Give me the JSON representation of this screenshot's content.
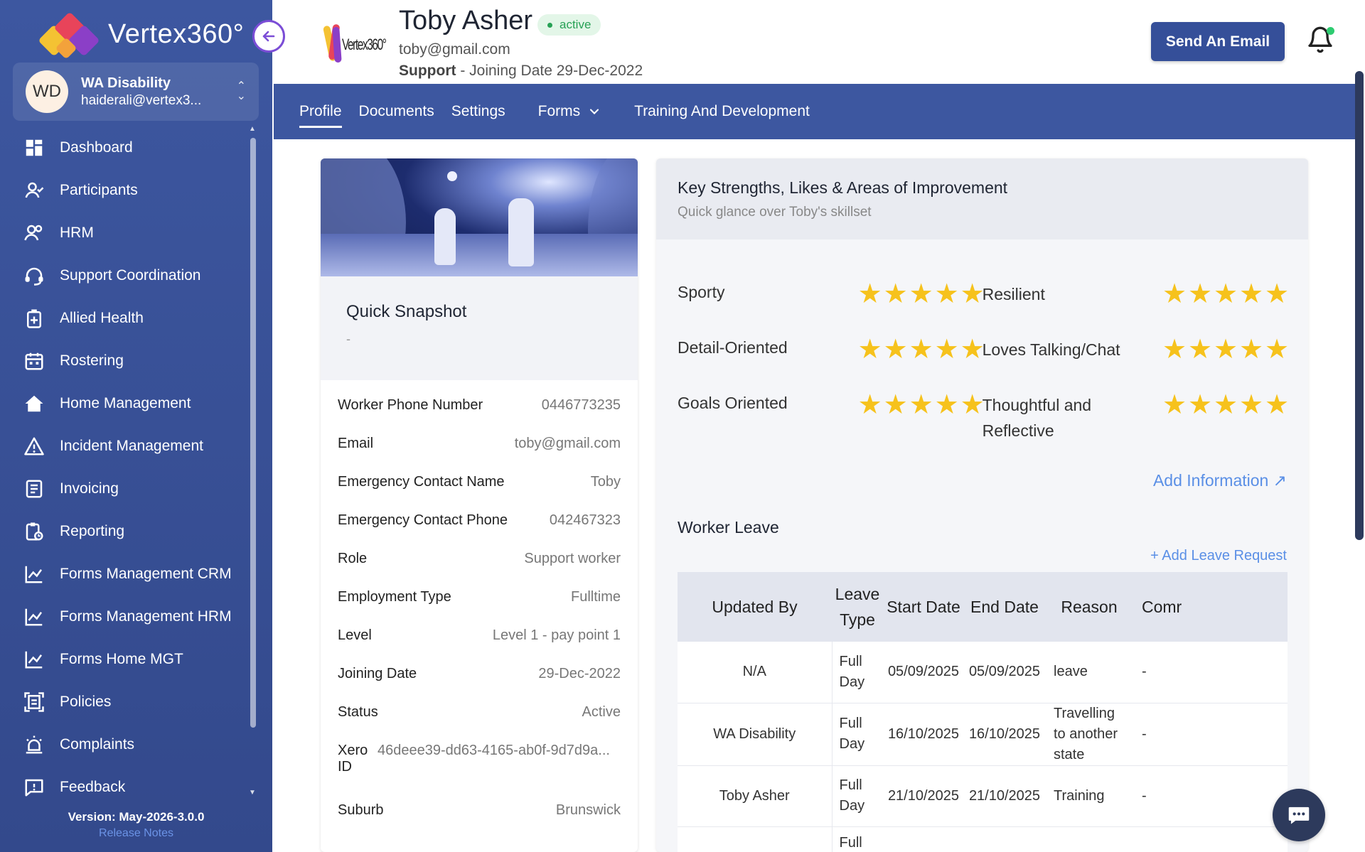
{
  "brand": {
    "name": "Vertex360°"
  },
  "org": {
    "initials": "WD",
    "name": "WA Disability",
    "email": "haiderali@vertex3..."
  },
  "nav": [
    {
      "label": "Dashboard",
      "icon": "dashboard-icon"
    },
    {
      "label": "Participants",
      "icon": "participants-icon"
    },
    {
      "label": "HRM",
      "icon": "hrm-icon"
    },
    {
      "label": "Support Coordination",
      "icon": "headset-icon"
    },
    {
      "label": "Allied Health",
      "icon": "medical-icon"
    },
    {
      "label": "Rostering",
      "icon": "calendar-icon"
    },
    {
      "label": "Home Management",
      "icon": "home-icon"
    },
    {
      "label": "Incident Management",
      "icon": "warning-icon"
    },
    {
      "label": "Invoicing",
      "icon": "invoice-icon"
    },
    {
      "label": "Reporting",
      "icon": "report-icon"
    },
    {
      "label": "Forms Management CRM",
      "icon": "chart-icon"
    },
    {
      "label": "Forms Management HRM",
      "icon": "chart-icon"
    },
    {
      "label": "Forms Home MGT",
      "icon": "chart-icon"
    },
    {
      "label": "Policies",
      "icon": "policy-icon"
    },
    {
      "label": "Complaints",
      "icon": "alarm-icon"
    },
    {
      "label": "Feedback",
      "icon": "feedback-icon"
    }
  ],
  "version": "Version: May-2026-3.0.0",
  "release_notes": "Release Notes",
  "header": {
    "logo_text": "Vertex360°",
    "user_name": "Toby Asher",
    "status": "active",
    "email": "toby@gmail.com",
    "role": "Support",
    "joining": " - Joining Date 29-Dec-2022",
    "send_email": "Send An Email"
  },
  "tabs": [
    {
      "label": "Profile",
      "active": true
    },
    {
      "label": "Documents"
    },
    {
      "label": "Settings"
    },
    {
      "label": "Forms"
    },
    {
      "label": "Training And Development"
    }
  ],
  "snapshot": {
    "title": "Quick Snapshot",
    "subtitle": "-",
    "details": [
      {
        "key": "Worker Phone Number",
        "value": "0446773235"
      },
      {
        "key": "Email",
        "value": "toby@gmail.com"
      },
      {
        "key": "Emergency Contact Name",
        "value": "Toby"
      },
      {
        "key": "Emergency Contact Phone",
        "value": "042467323"
      },
      {
        "key": "Role",
        "value": "Support worker"
      },
      {
        "key": "Employment Type",
        "value": "Fulltime"
      },
      {
        "key": "Level",
        "value": "Level 1 - pay point 1"
      },
      {
        "key": "Joining Date",
        "value": "29-Dec-2022"
      },
      {
        "key": "Status",
        "value": "Active"
      }
    ],
    "xero_key": "Xero ID",
    "xero_value": "46deee39-dd63-4165-ab0f-9d7d9a...",
    "suburb_key": "Suburb",
    "suburb_value": "Brunswick"
  },
  "strengths": {
    "title": "Key Strengths, Likes & Areas of Improvement",
    "subtitle": "Quick glance over Toby's skillset",
    "rows": [
      {
        "left": "Sporty",
        "left_stars": 5,
        "right": "Resilient",
        "right_stars": 5
      },
      {
        "left": "Detail-Oriented",
        "left_stars": 5,
        "right": "Loves Talking/Chat",
        "right_stars": 5
      },
      {
        "left": "Goals Oriented",
        "left_stars": 5,
        "right": "Thoughtful and Reflective",
        "right_stars": 5
      }
    ],
    "add_info": "Add Information ↗"
  },
  "leave": {
    "title": "Worker Leave",
    "add_request": "+ Add Leave Request",
    "columns": [
      "Updated By",
      "Leave Type",
      "Start Date",
      "End Date",
      "Reason",
      "Comr"
    ],
    "rows": [
      [
        "N/A",
        "Full Day",
        "05/09/2025",
        "05/09/2025",
        "leave",
        "-"
      ],
      [
        "WA Disability",
        "Full Day",
        "16/10/2025",
        "16/10/2025",
        "Travelling to another state",
        "-"
      ],
      [
        "Toby Asher",
        "Full Day",
        "21/10/2025",
        "21/10/2025",
        "Training",
        "-"
      ],
      [
        "",
        "Full",
        "",
        "",
        "",
        ""
      ]
    ]
  },
  "colors": {
    "sidebar": "#3d57a0",
    "accent": "#354f99",
    "star": "#f6c21c",
    "link": "#5a8fe6",
    "active_green": "#27a155"
  }
}
